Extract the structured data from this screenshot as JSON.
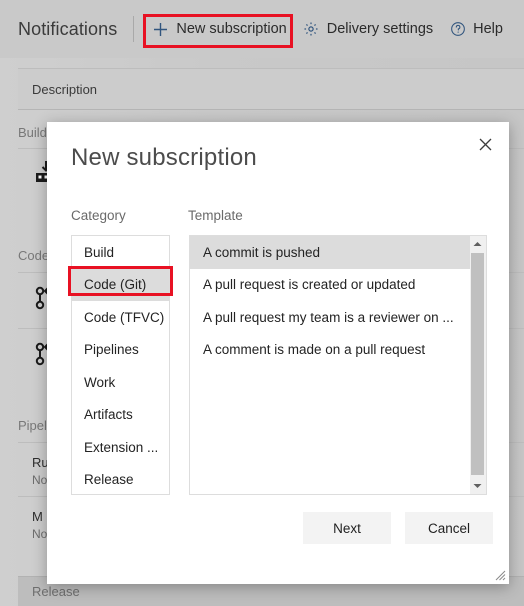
{
  "toolbar": {
    "page_title": "Notifications",
    "new_subscription_label": "New subscription",
    "new_subscription_icon": "plus-icon",
    "delivery_settings_label": "Delivery settings",
    "delivery_settings_icon": "gear-icon",
    "help_label": "Help",
    "help_icon": "question-circle-icon",
    "highlight_color": "#e81123",
    "icon_color": "#31557e"
  },
  "background": {
    "description_header": "Description",
    "groups": [
      {
        "label": "Build"
      },
      {
        "label": "Code"
      },
      {
        "label": "Pipelines"
      },
      {
        "label": "Release"
      }
    ],
    "rows": [
      {
        "icon": "build-icon",
        "title": "",
        "subtitle": ""
      },
      {
        "icon": "git-branch-icon",
        "title": "",
        "subtitle": ""
      },
      {
        "icon": "git-branch-icon",
        "title": "",
        "subtitle": ""
      },
      {
        "icon": "",
        "title": "Ru",
        "subtitle": "No"
      },
      {
        "icon": "",
        "title": "M",
        "subtitle": "No"
      }
    ]
  },
  "dialog": {
    "title": "New subscription",
    "close_icon": "close-icon",
    "category_label": "Category",
    "template_label": "Template",
    "categories": [
      {
        "label": "Build",
        "selected": false
      },
      {
        "label": "Code (Git)",
        "selected": true
      },
      {
        "label": "Code (TFVC)",
        "selected": false
      },
      {
        "label": "Pipelines",
        "selected": false
      },
      {
        "label": "Work",
        "selected": false
      },
      {
        "label": "Artifacts",
        "selected": false
      },
      {
        "label": "Extension ...",
        "selected": false
      },
      {
        "label": "Release",
        "selected": false
      }
    ],
    "templates": [
      {
        "label": "A commit is pushed",
        "selected": true
      },
      {
        "label": "A pull request is created or updated",
        "selected": false
      },
      {
        "label": "A pull request my team is a reviewer on ...",
        "selected": false
      },
      {
        "label": "A comment is made on a pull request",
        "selected": false
      }
    ],
    "scrollbar": {
      "up_arrow_icon": "chevron-up-icon",
      "down_arrow_icon": "chevron-down-icon"
    },
    "next_label": "Next",
    "cancel_label": "Cancel",
    "resize_grip_icon": "resize-grip-icon",
    "selection_color": "#dcdcdc",
    "highlight_color": "#e81123"
  }
}
